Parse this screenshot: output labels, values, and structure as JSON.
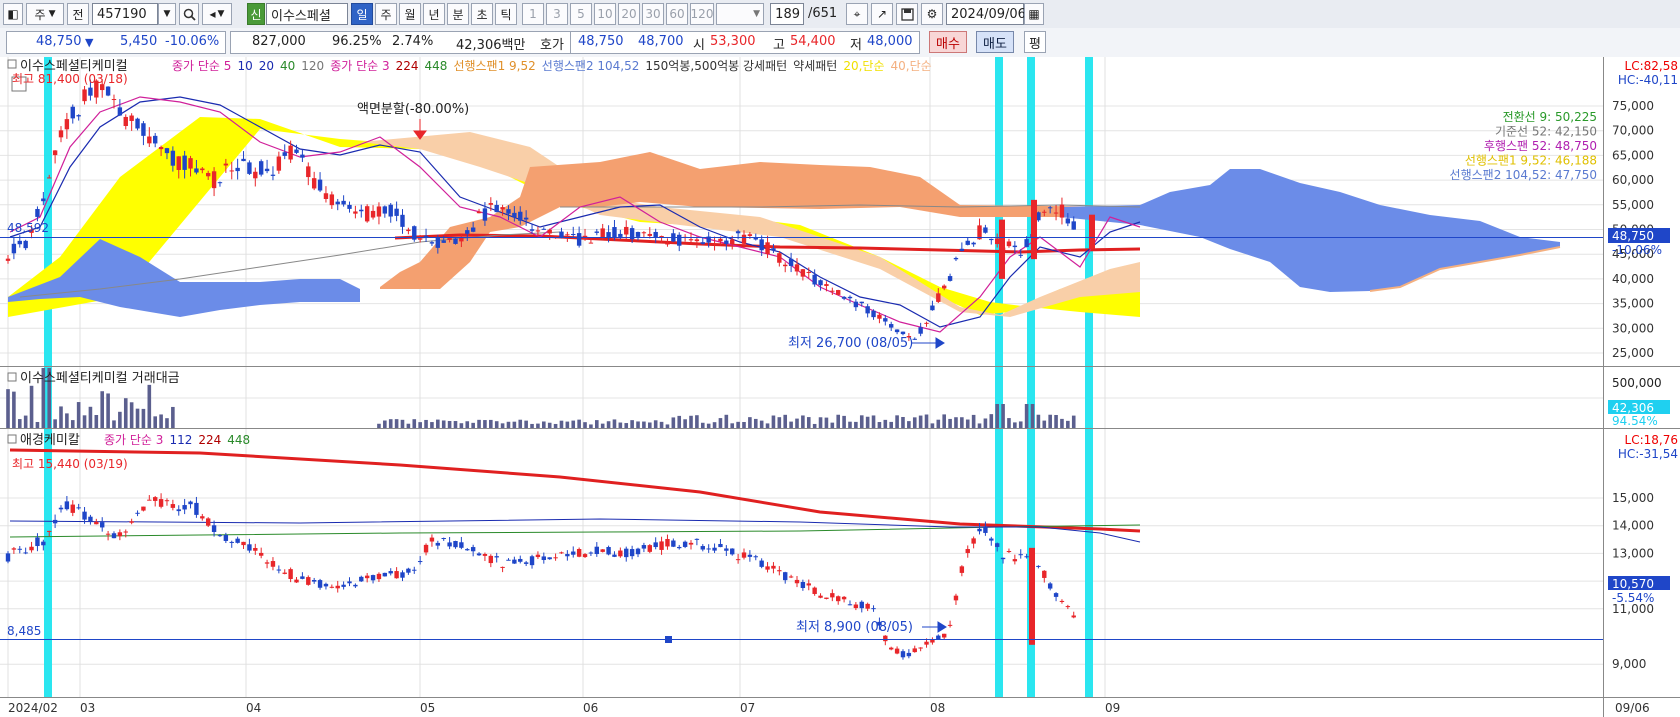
{
  "toolbar": {
    "period": "주",
    "prev_label": "전",
    "code": "457190",
    "name_badge": "신",
    "name": "이수스페셜",
    "intervals": [
      "일",
      "주",
      "월",
      "년",
      "분",
      "초",
      "틱"
    ],
    "numbers": [
      "1",
      "3",
      "5",
      "10",
      "20",
      "30",
      "60",
      "120"
    ],
    "count": "189",
    "total": "/651",
    "date": "2024/09/06"
  },
  "quote": {
    "price": "48,750",
    "arrow": "▼",
    "change": "5,450",
    "change_pct": "-10.06%",
    "volume": "827,000",
    "vol_ratio": "96.25%",
    "turnover": "2.74%",
    "amount": "42,306백만",
    "hoga_label": "호가",
    "ask": "48,750",
    "bid": "48,700",
    "open_label": "시",
    "open": "53,300",
    "high_label": "고",
    "high": "54,400",
    "low_label": "저",
    "low": "48,000",
    "buy": "매수",
    "sell": "매도",
    "flat": "평"
  },
  "colors": {
    "up": "#e8262a",
    "down": "#1f46c8",
    "cyan_band": "#1fe5ef",
    "cloud_yellow": "#ffff00",
    "cloud_orange": "#f4a070",
    "cloud_peach": "#f9cfa8",
    "cloud_blue": "#6b8ce8",
    "ma_red": "#e02020"
  },
  "main_panel": {
    "title": "이수스페셜티케미컬",
    "legend": [
      {
        "text": "종가 단순 5",
        "color": "#d0209a"
      },
      {
        "text": "10",
        "color": "#1a2bb0"
      },
      {
        "text": "20",
        "color": "#1a2bb0"
      },
      {
        "text": "40",
        "color": "#2a8a2a"
      },
      {
        "text": "120",
        "color": "#777777"
      },
      {
        "text": "종가 단순 3",
        "color": "#d0209a"
      },
      {
        "text": "224",
        "color": "#b00000"
      },
      {
        "text": "448",
        "color": "#2a8a2a"
      },
      {
        "text": "선행스팬1 9,52",
        "color": "#e0902a"
      },
      {
        "text": "선행스팬2 104,52",
        "color": "#5a7ad0"
      },
      {
        "text": "150억봉,500억봉 강세패턴",
        "color": "#333333"
      },
      {
        "text": "약세패턴",
        "color": "#333333"
      },
      {
        "text": "20,단순",
        "color": "#f0e000"
      },
      {
        "text": "40,단순",
        "color": "#f4b080"
      }
    ],
    "high_note": "최고 81,400 (03/18)",
    "split_note": "액면분할(-80.00%)",
    "low_note": "최저 26,700 (08/05)",
    "left_value": "48,592",
    "lc": "LC:82,58",
    "hc": "HC:-40,11",
    "price_tag": "48,750",
    "pct_tag": "-10.06%",
    "right_legend": [
      {
        "text": "전환선 9: 50,225",
        "color": "#2a9a2a"
      },
      {
        "text": "기준선 52: 42,150",
        "color": "#777777"
      },
      {
        "text": "후행스팬 52: 48,750",
        "color": "#b020b0"
      },
      {
        "text": "선행스팬1 9,52: 46,188",
        "color": "#e0c000"
      },
      {
        "text": "선행스팬2 104,52: 47,750",
        "color": "#5a7ad0"
      }
    ],
    "y_labels": [
      "75,000",
      "70,000",
      "65,000",
      "60,000",
      "55,000",
      "50,000",
      "45,000",
      "40,000",
      "35,000",
      "30,000",
      "25,000"
    ]
  },
  "volume_panel": {
    "title": "이수스페셜티케미컬 거래대금",
    "y_label": "500,000",
    "value_tag": "42,306",
    "pct_tag": "94.54%"
  },
  "sub_panel": {
    "title": "애경케미칼",
    "legend": [
      {
        "text": "종가 단순 3",
        "color": "#d0209a"
      },
      {
        "text": "112",
        "color": "#1a2bb0"
      },
      {
        "text": "224",
        "color": "#b00000"
      },
      {
        "text": "448",
        "color": "#2a8a2a"
      }
    ],
    "high_note": "최고 15,440 (03/19)",
    "low_note": "최저 8,900 (08/05)",
    "left_value": "8,485",
    "lc": "LC:18,76",
    "hc": "HC:-31,54",
    "price_tag": "10,570",
    "pct_tag": "-5.54%",
    "y_labels": [
      "15,000",
      "14,000",
      "13,000",
      "12,000",
      "11,000",
      "9,000"
    ]
  },
  "x_axis": {
    "labels": [
      "2024/02",
      "03",
      "04",
      "05",
      "06",
      "07",
      "08",
      "09"
    ],
    "right_label": "09/06"
  }
}
